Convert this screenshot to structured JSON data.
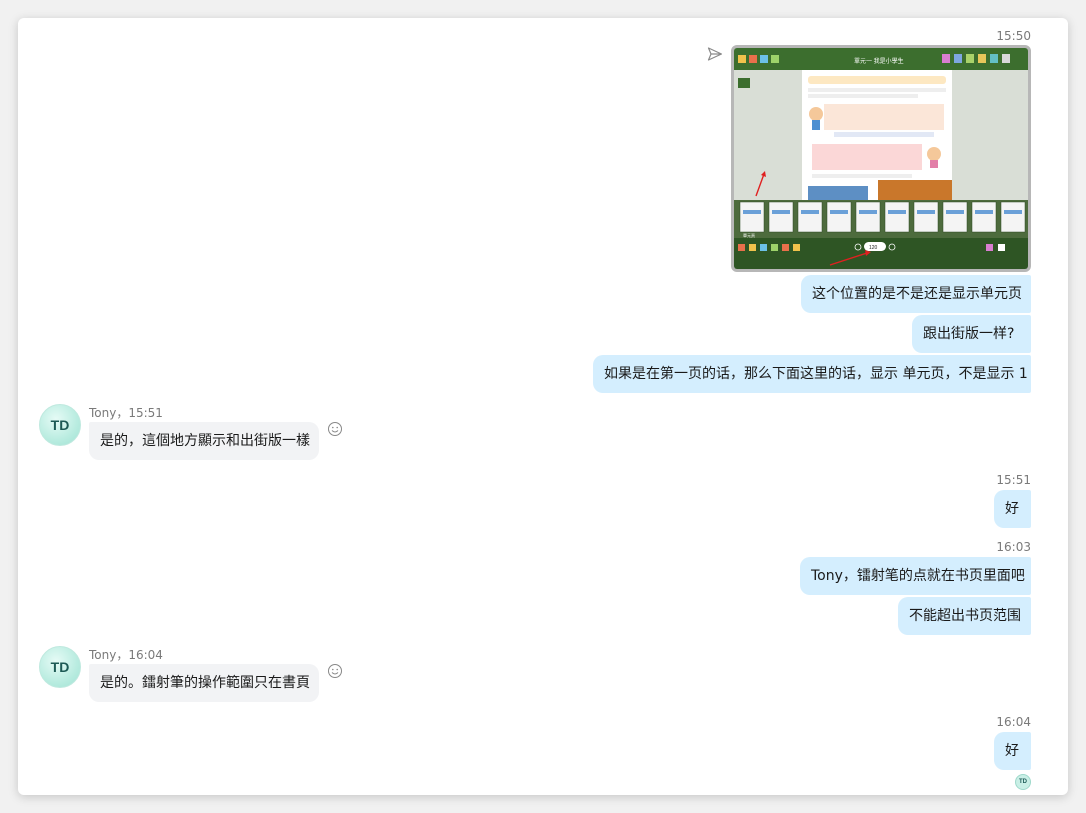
{
  "messages": {
    "m1_time": "15:50",
    "m1_text1": "这个位置的是不是还是显示单元页",
    "m1_text2": "跟出街版一样?",
    "m1_text3": "如果是在第一页的话，那么下面这里的话，显示 单元页，不是显示 1",
    "r1_sender": "Tony，15:51",
    "r1_text": "是的，這個地方顯示和出街版一樣",
    "m2_time": "15:51",
    "m2_text": "好",
    "m3_time": "16:03",
    "m3_text1": "Tony，镭射笔的点就在书页里面吧",
    "m3_text2": "不能超出书页范围",
    "r2_sender": "Tony，16:04",
    "r2_text": "是的。鐳射筆的操作範圍只在書頁",
    "m4_time": "16:04",
    "m4_text": "好"
  },
  "avatar": {
    "initials": "TD",
    "read_initials": "TD"
  },
  "screenshot": {
    "header_title": "單元一 我是小學生",
    "page_number": "120",
    "bottom_left_label": "單元頁"
  },
  "icons": {
    "send": "paper-plane-icon",
    "react": "smiley-icon"
  },
  "colors": {
    "outgoing_bubble": "#d4eefe",
    "incoming_bubble": "#f2f3f5",
    "app_green": "#3c6e2e"
  }
}
